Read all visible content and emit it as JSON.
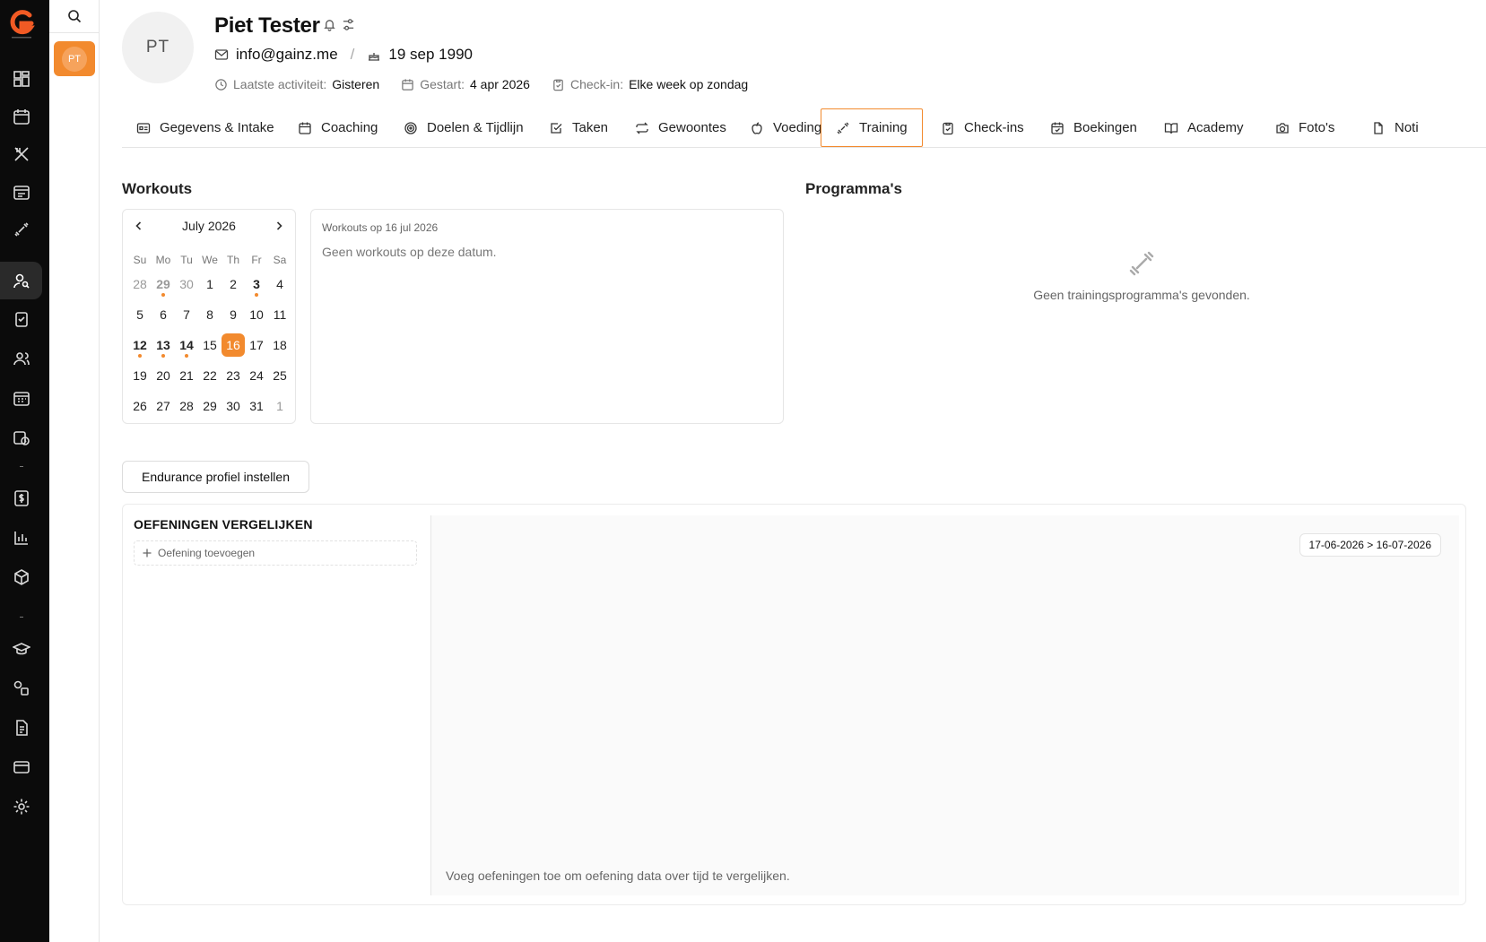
{
  "client": {
    "initials": "PT",
    "name": "Piet Tester",
    "email": "info@gainz.me",
    "birthday": "19 sep 1990",
    "last_activity_label": "Laatste activiteit:",
    "last_activity_value": "Gisteren",
    "started_label": "Gestart:",
    "started_value": "4 apr 2026",
    "checkin_label": "Check-in:",
    "checkin_value": "Elke week op zondag"
  },
  "sidebar": {
    "client_initials": "PT"
  },
  "tabs": [
    {
      "label": "Gegevens & Intake"
    },
    {
      "label": "Coaching"
    },
    {
      "label": "Doelen & Tijdlijn"
    },
    {
      "label": "Taken"
    },
    {
      "label": "Gewoontes"
    },
    {
      "label": "Voeding"
    },
    {
      "label": "Training"
    },
    {
      "label": "Check-ins"
    },
    {
      "label": "Boekingen"
    },
    {
      "label": "Academy"
    },
    {
      "label": "Foto's"
    },
    {
      "label": "Noti"
    }
  ],
  "workouts": {
    "title": "Workouts",
    "calendar_month": "July 2026",
    "weekdays": [
      "Su",
      "Mo",
      "Tu",
      "We",
      "Th",
      "Fr",
      "Sa"
    ],
    "weeks": [
      [
        "28",
        "29",
        "30",
        "1",
        "2",
        "3",
        "4"
      ],
      [
        "5",
        "6",
        "7",
        "8",
        "9",
        "10",
        "11"
      ],
      [
        "12",
        "13",
        "14",
        "15",
        "16",
        "17",
        "18"
      ],
      [
        "19",
        "20",
        "21",
        "22",
        "23",
        "24",
        "25"
      ],
      [
        "26",
        "27",
        "28",
        "29",
        "30",
        "31",
        "1"
      ]
    ],
    "panel_title": "Workouts op 16 jul 2026",
    "panel_empty": "Geen workouts op deze datum."
  },
  "programs": {
    "title": "Programma's",
    "empty": "Geen trainingsprogramma's gevonden."
  },
  "endurance_button": "Endurance profiel instellen",
  "compare": {
    "title": "OEFENINGEN VERGELIJKEN",
    "add_label": "Oefening toevoegen",
    "date_range": "17-06-2026 > 16-07-2026",
    "hint": "Voeg oefeningen toe om oefening data over tijd te vergelijken."
  },
  "colors": {
    "accent": "#f28a2e",
    "rail": "#0b0b0b"
  }
}
